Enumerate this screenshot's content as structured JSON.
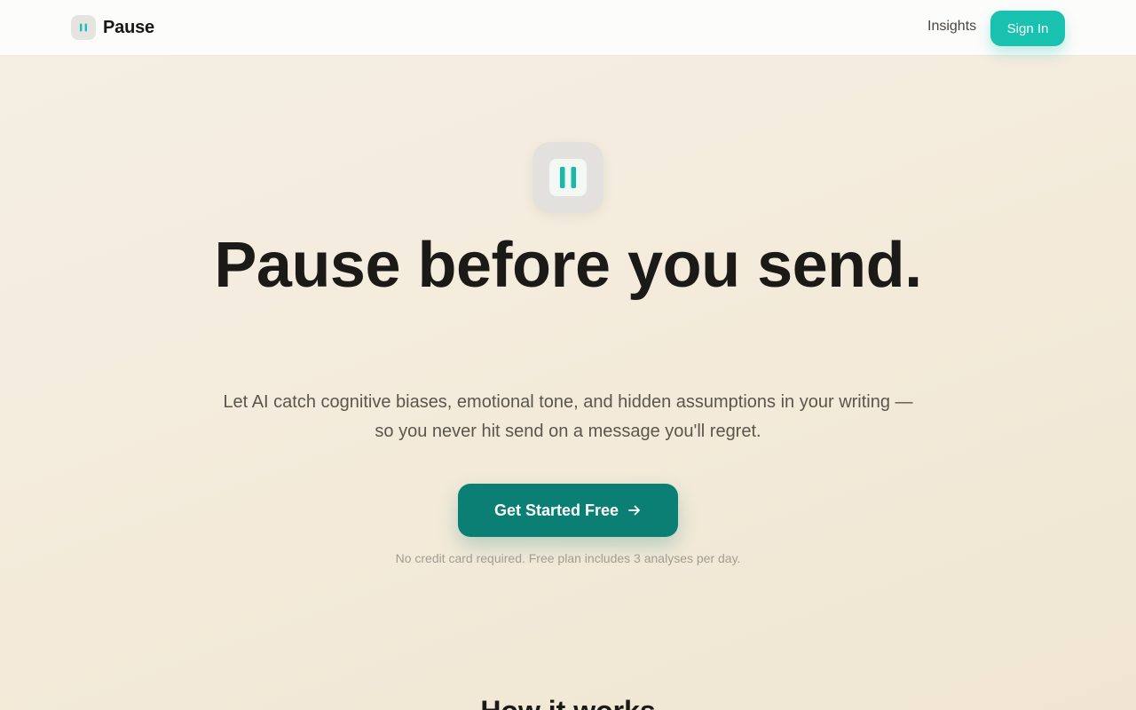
{
  "header": {
    "brand_name": "Pause",
    "brand_icon": "pause-icon",
    "nav": {
      "insights_label": "Insights"
    },
    "signin_label": "Sign In"
  },
  "hero": {
    "icon": "pause-icon",
    "title": "Pause before you send.",
    "subtitle": "Let AI catch cognitive biases, emotional tone, and hidden assumptions in your writing — so you never hit send on a message you'll regret.",
    "cta_label": "Get Started Free",
    "cta_icon": "arrow-right-icon",
    "note": "No credit card required. Free plan includes 3 analyses per day."
  },
  "sections": {
    "how_title": "How it works"
  },
  "colors": {
    "accent": "#18c2ae",
    "cta": "#0c7f74",
    "background": "#f5efe4"
  }
}
